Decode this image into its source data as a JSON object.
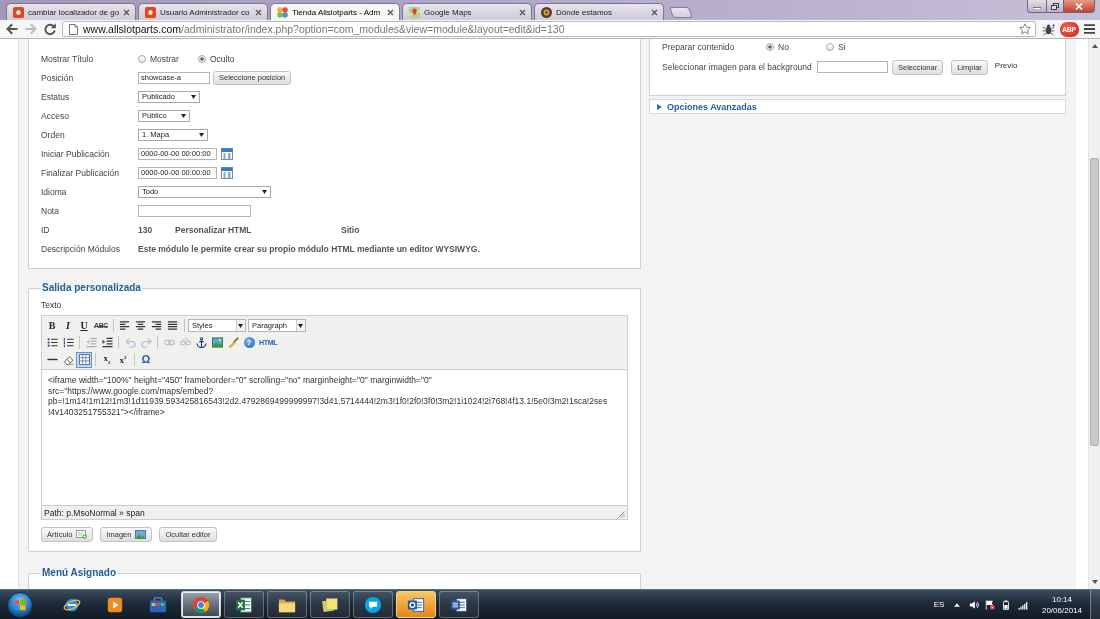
{
  "browser": {
    "tabs": [
      {
        "title": "cambiar localizador de go",
        "kind": "square",
        "selected": false
      },
      {
        "title": "Usuario Administrador co",
        "kind": "square",
        "selected": false
      },
      {
        "title": "Tienda Allslotparts - Adm",
        "kind": "pinwheel",
        "selected": true
      },
      {
        "title": "Google Maps",
        "kind": "map",
        "selected": false
      },
      {
        "title": "Dónde estamos",
        "kind": "disc",
        "selected": false
      }
    ],
    "nav_buttons": [
      {
        "kind": "back",
        "disabled": false
      },
      {
        "kind": "forward",
        "disabled": true
      },
      {
        "kind": "reload",
        "disabled": false
      }
    ],
    "address": {
      "host": "www.allslotparts.com",
      "path": "/administrator/index.php?option=com_modules&view=module&layout=edit&id=130"
    },
    "adblock_badge": "ABP"
  },
  "module_form": {
    "fields": [
      {
        "label": "Mostrar Título",
        "kind": "radio",
        "options": [
          {
            "label": "Mostrar",
            "selected": false
          },
          {
            "label": "Oculto",
            "selected": true
          }
        ]
      },
      {
        "label": "Posición",
        "kind": "text_button",
        "value": "showcase-a",
        "button": "Seleccione posicion"
      },
      {
        "label": "Estatus",
        "kind": "select",
        "value": "Publicado"
      },
      {
        "label": "Acceso",
        "kind": "select",
        "value": "Público"
      },
      {
        "label": "Orden",
        "kind": "select",
        "value": "1. Mapa"
      },
      {
        "label": "Iniciar Publicación",
        "kind": "date",
        "value": "0000-00-00 00:00:00"
      },
      {
        "label": "Finalizar Publicación",
        "kind": "date",
        "value": "0000-00-00 00:00:00"
      },
      {
        "label": "Idioma",
        "kind": "select",
        "value": "Todo"
      },
      {
        "label": "Nota",
        "kind": "text"
      },
      {
        "label": "ID",
        "kind": "info",
        "values": [
          "130",
          "Personalizar HTML",
          "Sitio"
        ]
      },
      {
        "label": "Descripción Módulos",
        "kind": "description",
        "text": "Este módulo le permite crear su propio módulo HTML mediante un editor WYSIWYG."
      }
    ]
  },
  "custom_output": {
    "legend": "Salida personalizada",
    "label": "Texto",
    "editor": {
      "toolbar": [
        [
          [
            {
              "kind": "bold",
              "text": "B",
              "disabled": false,
              "selected": false
            },
            {
              "kind": "italic",
              "text": "I",
              "disabled": false,
              "selected": false
            },
            {
              "kind": "underline",
              "text": "U",
              "disabled": false,
              "selected": false
            },
            {
              "kind": "strikethrough",
              "text": "ABC",
              "disabled": false,
              "selected": false
            }
          ],
          [
            {
              "kind": "align_left",
              "disabled": false,
              "selected": false
            },
            {
              "kind": "align_center",
              "disabled": false,
              "selected": false
            },
            {
              "kind": "align_right",
              "disabled": false,
              "selected": false
            },
            {
              "kind": "align_justify",
              "disabled": false,
              "selected": false
            }
          ],
          [
            {
              "kind": "dropdown",
              "text": "Styles",
              "disabled": false,
              "selected": false
            },
            {
              "kind": "dropdown",
              "text": "Paragraph",
              "disabled": false,
              "selected": false
            }
          ]
        ],
        [
          [
            {
              "kind": "bullet_list",
              "disabled": false,
              "selected": false
            },
            {
              "kind": "numbered_list",
              "disabled": false,
              "selected": false
            }
          ],
          [
            {
              "kind": "outdent",
              "disabled": true,
              "selected": false
            },
            {
              "kind": "indent",
              "disabled": false,
              "selected": false
            }
          ],
          [
            {
              "kind": "undo",
              "disabled": true,
              "selected": false
            },
            {
              "kind": "redo",
              "disabled": true,
              "selected": false
            }
          ],
          [
            {
              "kind": "link",
              "disabled": true,
              "selected": false
            },
            {
              "kind": "unlink",
              "disabled": true,
              "selected": false
            },
            {
              "kind": "anchor",
              "disabled": false,
              "selected": false
            },
            {
              "kind": "image",
              "disabled": false,
              "selected": false
            },
            {
              "kind": "cleanup",
              "disabled": false,
              "selected": false
            },
            {
              "kind": "help",
              "text": "?",
              "disabled": false,
              "selected": false
            },
            {
              "kind": "html_source",
              "text": "HTML",
              "disabled": false,
              "selected": false
            }
          ]
        ],
        [
          [
            {
              "kind": "hr",
              "disabled": false,
              "selected": false
            },
            {
              "kind": "remove_format",
              "disabled": false,
              "selected": false
            },
            {
              "kind": "visual_aid",
              "disabled": false,
              "selected": true
            }
          ],
          [
            {
              "kind": "subscript",
              "text": "x$_{2}$",
              "disabled": false,
              "selected": false
            },
            {
              "kind": "superscript",
              "text": "x$^{2}$",
              "disabled": false,
              "selected": false
            }
          ],
          [
            {
              "kind": "charmap",
              "text": "Ω",
              "disabled": false,
              "selected": false
            }
          ]
        ]
      ],
      "content_lines": [
        "<iframe width=\"100%\" height=\"450\" frameborder=\"0\" scrolling=\"no\" marginheight=\"0\" marginwidth=\"0\"",
        "src=\"https://www.google.com/maps/embed?",
        "pb=!1m14!1m12!1m3!1d11939.593425816543!2d2.4792869499999997!3d41.5714444!2m3!1f0!2f0!3f0!3m2!1i1024!2i768!4f13.1!5e0!3m2!1sca!2ses",
        "!4v1403251755321\"></iframe>"
      ],
      "path": "Path: p.MsoNormal » span"
    },
    "buttons": [
      {
        "label": "Artículo",
        "kind": "article"
      },
      {
        "label": "Imagen",
        "kind": "image"
      },
      {
        "label": "Ocultar editor",
        "kind": "toggle"
      }
    ]
  },
  "assigned_menu": {
    "legend": "Menú Asignado"
  },
  "options_panel": {
    "fields": [
      {
        "label": "Preparar contenido",
        "kind": "radio",
        "options": [
          {
            "label": "No",
            "selected": true
          },
          {
            "label": "Si",
            "selected": false
          }
        ]
      },
      {
        "label": "Seleccionar imagen para el background",
        "kind": "image_picker",
        "buttons": [
          "Seleccionar",
          "Limpiar"
        ],
        "preview": "Previo"
      }
    ]
  },
  "advanced_options": {
    "title": "Opciones Avanzadas",
    "expanded": false
  },
  "taskbar": {
    "apps": [
      {
        "kind": "globe",
        "running": false,
        "selected": false,
        "attention": false
      },
      {
        "kind": "play",
        "running": false,
        "selected": false,
        "attention": false
      },
      {
        "kind": "toolbox",
        "running": false,
        "selected": false,
        "attention": false
      },
      {
        "kind": "round_logo",
        "running": true,
        "selected": true,
        "attention": false
      },
      {
        "kind": "spreadsheet",
        "running": true,
        "selected": false,
        "attention": false
      },
      {
        "kind": "folder",
        "running": true,
        "selected": false,
        "attention": false
      },
      {
        "kind": "notes",
        "running": true,
        "selected": false,
        "attention": false
      },
      {
        "kind": "chat",
        "running": true,
        "selected": false,
        "attention": false
      },
      {
        "kind": "mail",
        "running": true,
        "selected": false,
        "attention": true
      },
      {
        "kind": "document",
        "running": true,
        "selected": false,
        "attention": false
      }
    ],
    "tray": {
      "language": "ES",
      "time": "10:14",
      "date": "20/06/2014"
    }
  }
}
